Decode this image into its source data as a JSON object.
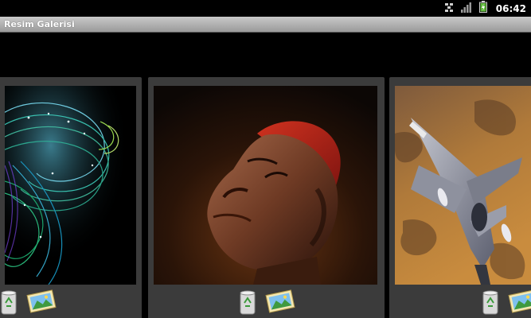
{
  "status_bar": {
    "time": "06:42",
    "icons": [
      "usb-debug-icon",
      "signal-icon",
      "battery-icon"
    ]
  },
  "app": {
    "title": "Resim Galerisi"
  },
  "gallery": {
    "items": [
      {
        "image": "abstract-fractal-spiral",
        "actions": [
          "delete-recycle-icon",
          "set-wallpaper-icon"
        ]
      },
      {
        "image": "portrait-red-cap",
        "actions": [
          "delete-recycle-icon",
          "set-wallpaper-icon"
        ]
      },
      {
        "image": "fighter-jet-desert",
        "actions": [
          "delete-recycle-icon",
          "set-wallpaper-icon"
        ]
      }
    ]
  },
  "colors": {
    "title_bar": "#b4b4b4",
    "card_bg": "#3b3b3b",
    "background": "#000000",
    "recycle_green": "#3a9a3a",
    "cap_red": "#c0281e"
  }
}
